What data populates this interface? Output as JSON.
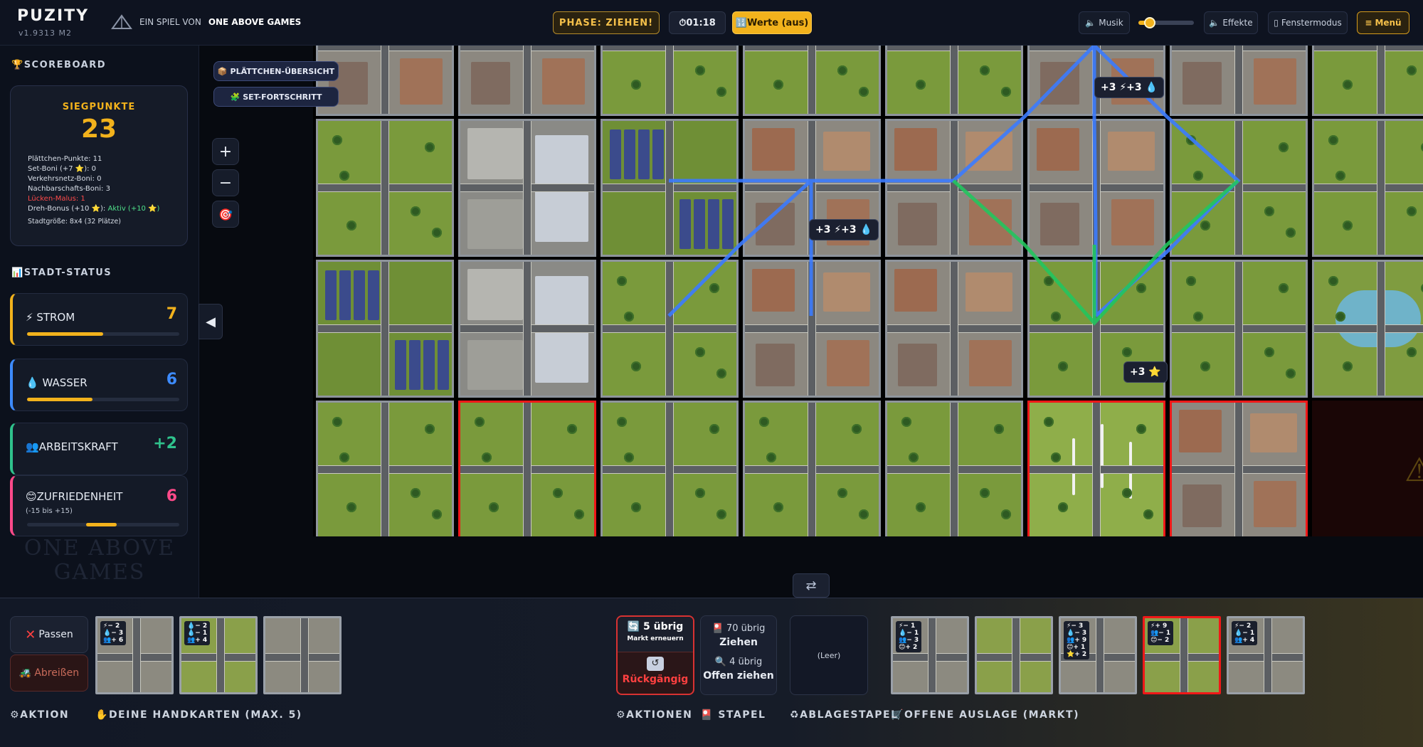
{
  "app": {
    "title": "PUZITY",
    "version": "v1.9313 M2",
    "tagline_prefix": "EIN SPIEL VON",
    "tagline_brand": "ONE ABOVE GAMES"
  },
  "topbar": {
    "phase": "PHASE: ZIEHEN!",
    "timer": "01:18",
    "werte": "Werte (aus)",
    "musik": "Musik",
    "volume": 0.2,
    "effekte": "Effekte",
    "fenstermodus": "Fenstermodus",
    "menu": "Menü"
  },
  "scoreboard": {
    "title": "SCOREBOARD",
    "siegpunkte_label": "SIEGPUNKTE",
    "siegpunkte": "23",
    "lines": {
      "plaettchen": "Plättchen-Punkte: 11",
      "set": "Set-Boni (+7 ⭐): 0",
      "verkehr": "Verkehrsnetz-Boni: 0",
      "nachbarschaft": "Nachbarschafts-Boni: 3",
      "luecken": "Lücken-Malus: 1",
      "dreh_prefix": "Dreh-Bonus (+10 ⭐):",
      "dreh_aktiv": "Aktiv (+10 ⭐)",
      "stadtgroesse": "Stadtgröße: 8x4 (32 Plätze)"
    }
  },
  "stadt_status": {
    "title": "STADT-STATUS",
    "items": [
      {
        "label": "STROM",
        "value": "7",
        "color": "#f2b21c",
        "fill": 0.5
      },
      {
        "label": "WASSER",
        "value": "6",
        "color": "#3d8bff",
        "fill": 0.43
      },
      {
        "label": "ARBEITSKRAFT",
        "value": "+2",
        "color": "#2fc28c"
      },
      {
        "label": "ZUFRIEDENHEIT",
        "sub": "(-15 bis +15)",
        "value": "6",
        "color": "#ff4a8a",
        "fill": 0.2
      }
    ]
  },
  "watermark": {
    "line1": "ONE ABOVE",
    "line2": "GAMES"
  },
  "board": {
    "buttons": {
      "uebersicht": "PLÄTTCHEN-ÜBERSICHT",
      "set": "SET-FORTSCHRITT"
    },
    "bonuses": [
      "+3 ⚡+3 💧",
      "+3 ⚡+3 💧",
      "+3 ⭐"
    ]
  },
  "bottom": {
    "passen": "Passen",
    "abreissen": "Abreißen",
    "aktion_label": "AKTION",
    "handkarten_label": "DEINE HANDKARTEN (MAX. 5)",
    "hand": [
      {
        "badge": [
          "⚡− 2",
          "💧− 3",
          "👥+ 6"
        ]
      },
      {
        "badge": [
          "💧− 2",
          "💧− 1",
          "👥+ 4"
        ]
      },
      {
        "badge": []
      }
    ],
    "markt_count": "5 übrig",
    "markt_label": "Markt erneuern",
    "rueckgaengig": "Rückgängig",
    "stapel_count": "70 übrig",
    "ziehen": "Ziehen",
    "offen_count": "4 übrig",
    "offen_ziehen": "Offen ziehen",
    "leer": "(Leer)",
    "aktionen_label": "AKTIONEN",
    "stapel_label": "STAPEL",
    "ablage_label": "ABLAGESTAPEL",
    "markt_auslage_label": "OFFENE AUSLAGE (MARKT)",
    "market": [
      {
        "badge": [
          "⚡− 1",
          "💧− 1",
          "👥− 3",
          "😊+ 2"
        ]
      },
      {
        "badge": []
      },
      {
        "badge": [
          "⚡− 3",
          "💧− 3",
          "👥+ 9",
          "😊+ 1",
          "⭐+ 2"
        ]
      },
      {
        "badge": [
          "⚡+ 9",
          "👥− 1",
          "😊− 2"
        ]
      },
      {
        "badge": [
          "⚡− 2",
          "💧− 1",
          "👥+ 4"
        ]
      }
    ]
  },
  "colors": {
    "accent": "#f2b21c",
    "danger": "#f01818",
    "power_line": "#3b7bff",
    "worker_line": "#22c55e"
  }
}
